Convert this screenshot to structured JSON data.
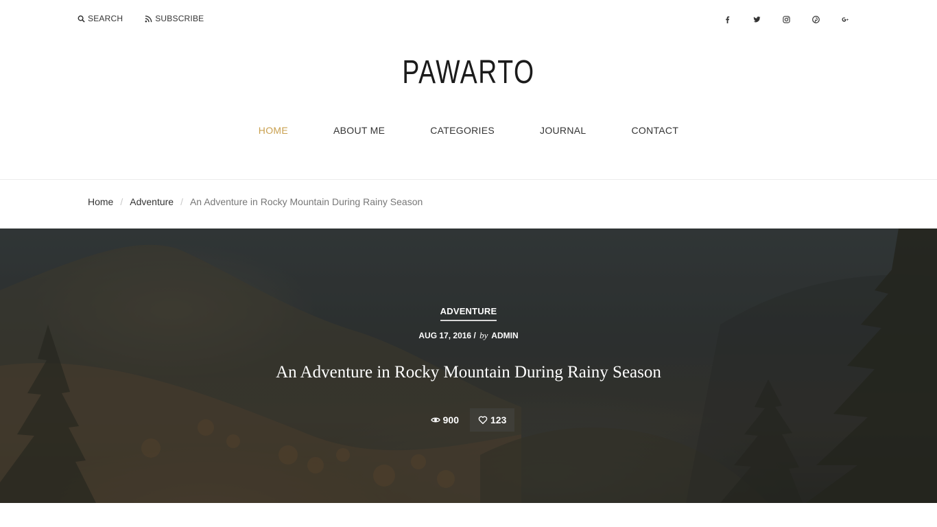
{
  "topbar": {
    "search_label": "SEARCH",
    "subscribe_label": "SUBSCRIBE",
    "socials": [
      "facebook-icon",
      "twitter-icon",
      "instagram-icon",
      "pinterest-icon",
      "google-plus-icon"
    ]
  },
  "logo": "PAWARTO",
  "nav": {
    "items": [
      {
        "label": "HOME"
      },
      {
        "label": "ABOUT ME"
      },
      {
        "label": "CATEGORIES"
      },
      {
        "label": "JOURNAL"
      },
      {
        "label": "CONTACT"
      }
    ],
    "active_color": "#c9a04f"
  },
  "breadcrumb": {
    "home": "Home",
    "category": "Adventure",
    "current": "An Adventure in Rocky Mountain During Rainy Season"
  },
  "post": {
    "category": "ADVENTURE",
    "date": "AUG 17, 2016",
    "by": "by",
    "author": "ADMIN",
    "title": "An Adventure in Rocky Mountain During Rainy Season",
    "views": "900",
    "likes": "123"
  }
}
